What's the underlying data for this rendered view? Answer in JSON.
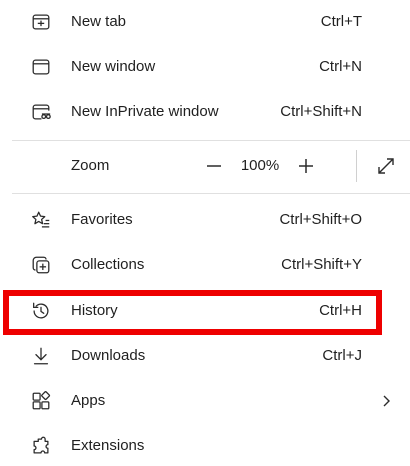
{
  "menu": {
    "new_tab": {
      "label": "New tab",
      "shortcut": "Ctrl+T",
      "icon": "new-tab-icon"
    },
    "new_window": {
      "label": "New window",
      "shortcut": "Ctrl+N",
      "icon": "new-window-icon"
    },
    "new_inprivate": {
      "label": "New InPrivate window",
      "shortcut": "Ctrl+Shift+N",
      "icon": "inprivate-icon"
    },
    "zoom": {
      "label": "Zoom",
      "value": "100%",
      "zoom_out_symbol": "—",
      "zoom_in_symbol": "+",
      "icons": {
        "out": "minus-icon",
        "in": "plus-icon",
        "fullscreen": "fullscreen-icon"
      }
    },
    "favorites": {
      "label": "Favorites",
      "shortcut": "Ctrl+Shift+O",
      "icon": "star-list-icon"
    },
    "collections": {
      "label": "Collections",
      "shortcut": "Ctrl+Shift+Y",
      "icon": "collections-icon"
    },
    "history": {
      "label": "History",
      "shortcut": "Ctrl+H",
      "icon": "history-icon"
    },
    "downloads": {
      "label": "Downloads",
      "shortcut": "Ctrl+J",
      "icon": "download-icon"
    },
    "apps": {
      "label": "Apps",
      "icon": "apps-icon",
      "submenu_icon": "chevron-right-icon"
    },
    "extensions": {
      "label": "Extensions",
      "icon": "extensions-icon"
    }
  },
  "colors": {
    "highlight_border": "#ee0000",
    "text": "#1f1f1f",
    "divider": "#e0e0e0"
  }
}
